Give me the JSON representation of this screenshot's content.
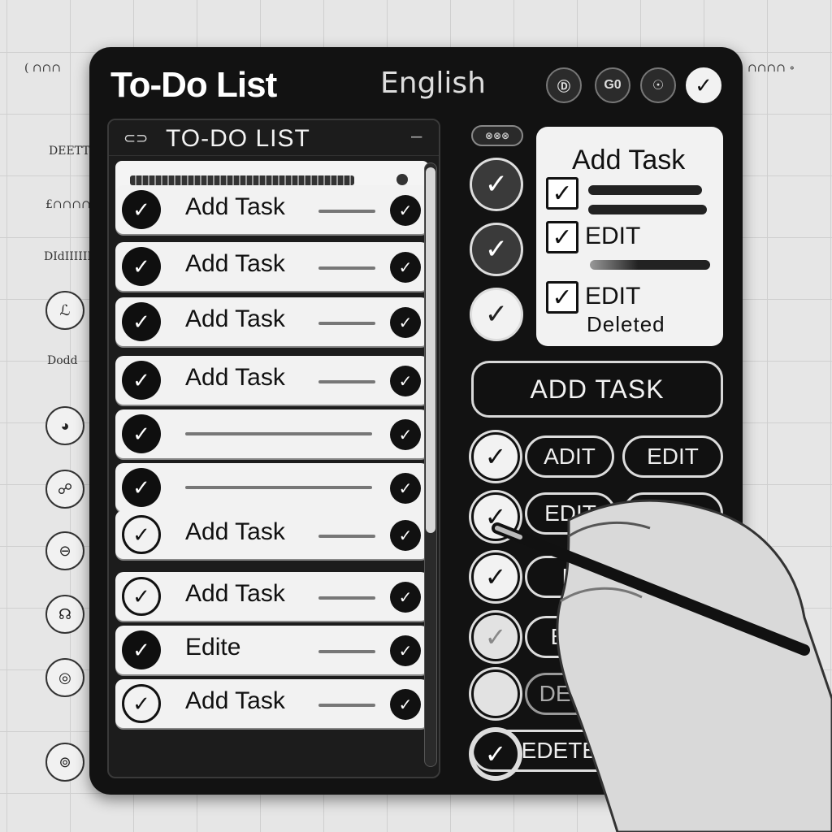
{
  "background": {
    "texts": [
      "( ∩∩∩",
      "∩∩∩∩ ∘",
      "DEETT",
      "£∩∩∩∩",
      "DIdIIIIID",
      "Dodd"
    ]
  },
  "header": {
    "title": "To-Do List",
    "language": "English",
    "buttons": [
      "Ⓓ",
      "G0",
      "☉",
      "✓"
    ]
  },
  "list": {
    "title": "TO-DO LIST",
    "tasks": [
      {
        "label": "Add Task",
        "style": "filled"
      },
      {
        "label": "Add Task",
        "style": "filled"
      },
      {
        "label": "Add Task",
        "style": "filled"
      },
      {
        "label": "Add Task",
        "style": "filled"
      },
      {
        "label": "",
        "style": "filled"
      },
      {
        "label": "",
        "style": "filled"
      },
      {
        "label": "Add Task",
        "style": "hollow"
      },
      {
        "label": "Add Task",
        "style": "hollow"
      },
      {
        "label": "Edite",
        "style": "filled"
      },
      {
        "label": "Add Task",
        "style": "hollow"
      }
    ]
  },
  "top_chip": "⊗⊗⊗",
  "card": {
    "heading": "Add Task",
    "edit1": "EDIT",
    "edit2": "EDIT",
    "deleted": "Deleted"
  },
  "add_button": "ADD TASK",
  "actions": [
    {
      "pill1": "ADIT",
      "pill2": "EDIT"
    },
    {
      "pill1": "EDIT",
      "pill2": ""
    },
    {
      "pill1": "E",
      "pill2": ""
    },
    {
      "pill1": "EDI",
      "pill2": ""
    },
    {
      "pill1": "DEET",
      "pill2": ""
    },
    {
      "pill1": "EDETE",
      "pill2": ""
    }
  ]
}
